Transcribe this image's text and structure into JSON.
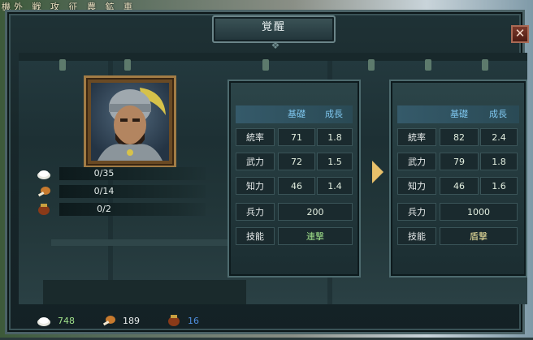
{
  "top_menu": {
    "text": "機外 戦 攻 征 農 鉱 車"
  },
  "window": {
    "title": "覚醒",
    "close_label": "✕",
    "ornament": "❖"
  },
  "resources": [
    {
      "icon": "rice-icon",
      "value": "0/35"
    },
    {
      "icon": "meat-leg-icon",
      "value": "0/14"
    },
    {
      "icon": "wine-jar-icon",
      "value": "0/2"
    }
  ],
  "stats_before": {
    "headers": [
      "基礎",
      "成長"
    ],
    "rows": [
      {
        "label": "統率",
        "base": "71",
        "growth": "1.8"
      },
      {
        "label": "武力",
        "base": "72",
        "growth": "1.5"
      },
      {
        "label": "知力",
        "base": "46",
        "growth": "1.4"
      }
    ],
    "troops": {
      "label": "兵力",
      "value": "200"
    },
    "skill": {
      "label": "技能",
      "value": "連撃"
    }
  },
  "stats_after": {
    "headers": [
      "基礎",
      "成長"
    ],
    "rows": [
      {
        "label": "統率",
        "base": "82",
        "growth": "2.4"
      },
      {
        "label": "武力",
        "base": "79",
        "growth": "1.8"
      },
      {
        "label": "知力",
        "base": "46",
        "growth": "1.6"
      }
    ],
    "troops": {
      "label": "兵力",
      "value": "1000"
    },
    "skill": {
      "label": "技能",
      "value": "盾撃"
    }
  },
  "inventory": [
    {
      "icon": "rice-icon",
      "value": "748",
      "color": "#9fe08a"
    },
    {
      "icon": "meat-leg-icon",
      "value": "189",
      "color": "#e8ecec"
    },
    {
      "icon": "wine-jar-icon",
      "value": "16",
      "color": "#4f8fe0"
    }
  ],
  "colors": {
    "header_text": "#7fc7ef",
    "arrow": "#e7c06a",
    "frame": "#a27c45"
  }
}
